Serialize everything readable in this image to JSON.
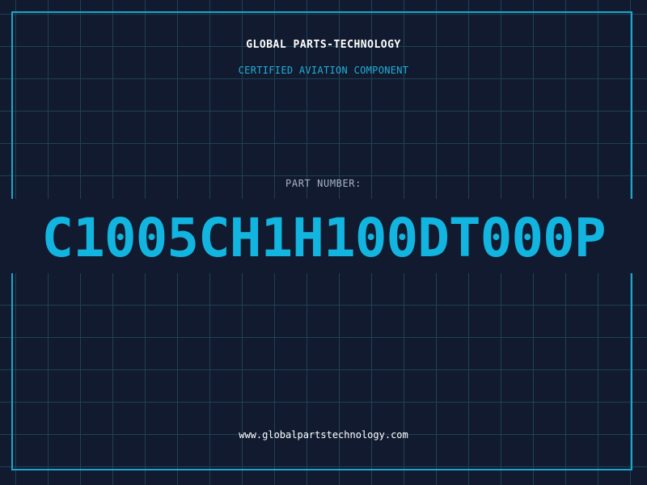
{
  "company_name": "GLOBAL PARTS-TECHNOLOGY",
  "subtitle": "CERTIFIED AVIATION COMPONENT",
  "part_number_label": "PART NUMBER:",
  "part_number": "C1005CH1H100DT000P",
  "website": "www.globalpartstechnology.com",
  "colors": {
    "background": "#111a2e",
    "grid": "#1f4256",
    "accent": "#12b4e0",
    "text": "#ffffff"
  }
}
